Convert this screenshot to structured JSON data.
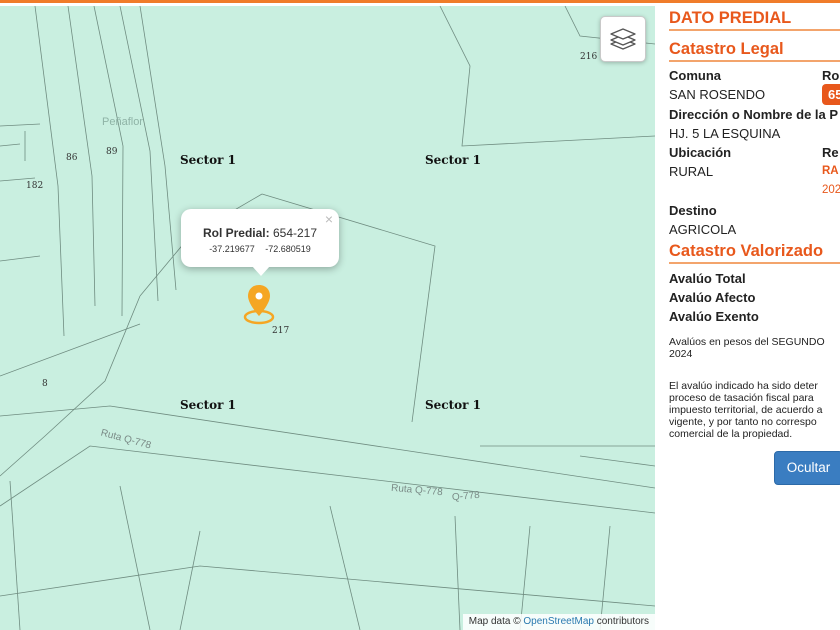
{
  "map": {
    "place_name": "Peñaflor",
    "sector_labels": [
      "Sector 1",
      "Sector 1",
      "Sector 1",
      "Sector 1"
    ],
    "parcel_numbers": [
      "216",
      "86",
      "89",
      "182",
      "217",
      "8"
    ],
    "road_labels": [
      "Ruta Q-778",
      "Ruta Q-778",
      "Q-778"
    ],
    "layers_button_icon": "layers-icon",
    "marker_icon": "map-pin-icon",
    "popup": {
      "label": "Rol Predial:",
      "value": "654-217",
      "lat": "-37.219677",
      "lon": "-72.680519",
      "close": "×"
    },
    "attribution": {
      "prefix": "Map data ©",
      "link": "OpenStreetMap",
      "suffix": "contributors"
    }
  },
  "panel": {
    "title": "DATO PREDIAL",
    "legal_section": "Catastro Legal",
    "comuna_label": "Comuna",
    "comuna_value": "SAN ROSENDO",
    "rol_label": "Ro",
    "rol_badge": "65",
    "direccion_label": "Dirección o Nombre de la P",
    "direccion_value": "HJ. 5 LA ESQUINA",
    "ubicacion_label": "Ubicación",
    "ubicacion_value": "RURAL",
    "re_label": "Re",
    "ra_value": "RA",
    "year_value": "202",
    "destino_label": "Destino",
    "destino_value": "AGRICOLA",
    "valorizado_section": "Catastro Valorizado",
    "avaluo_total_label": "Avalúo Total",
    "avaluo_afecto_label": "Avalúo Afecto",
    "avaluo_exento_label": "Avalúo Exento",
    "note_line1": "Avalúos en pesos del SEGUNDO",
    "note_line2": "2024",
    "disclaimer_lines": [
      "El avalúo indicado ha sido deter",
      "proceso de tasación fiscal para",
      "impuesto territorial, de acuerdo a",
      "vigente, y por tanto no correspo",
      "comercial de la propiedad."
    ],
    "hide_button": "Ocultar"
  },
  "colors": {
    "accent": "#e8581c",
    "map_bg": "#c9efe0",
    "button": "#3a7dc1",
    "marker": "#f5a623"
  }
}
